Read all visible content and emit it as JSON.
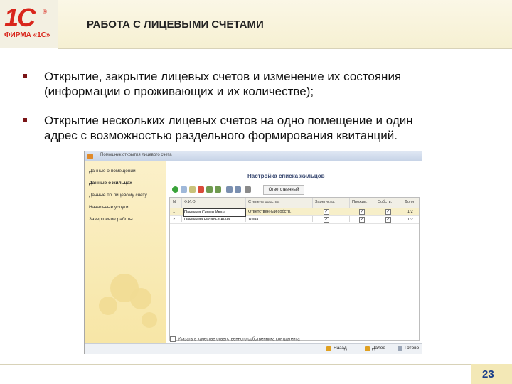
{
  "brand": {
    "logo_text": "1С",
    "logo_registered": "®",
    "caption": "ФИРМА «1С»"
  },
  "slide": {
    "title": "РАБОТА С ЛИЦЕВЫМИ СЧЕТАМИ",
    "bullets": [
      {
        "line1": "Открытие, закрытие лицевых счетов и изменение их состояния",
        "line2": "(информации о проживающих и их количестве);"
      },
      {
        "line1": "Открытие нескольких лицевых счетов на одно помещение и один",
        "line2": "адрес с возможностью раздельного формирования квитанций."
      }
    ],
    "page_number": "23"
  },
  "window": {
    "title": "Помощник открытия лицевого счета",
    "nav": [
      {
        "label": "Данные о помещении",
        "active": false
      },
      {
        "label": "Данные о жильцах",
        "active": true
      },
      {
        "label": "Данные по лицевому счету",
        "active": false
      },
      {
        "label": "Начальные услуги",
        "active": false
      },
      {
        "label": "Завершение работы",
        "active": false
      }
    ],
    "panel_title": "Настройка списка жильцов",
    "toolbar": {
      "responsible_label": "Ответственный"
    },
    "grid": {
      "headers": [
        "N",
        "Ф.И.О.",
        "Степень родства",
        "Зарегистр.",
        "Прожив.",
        "Собств.",
        "Доля"
      ],
      "rows": [
        {
          "n": "1",
          "fio": "Пакшеев Семен Иван",
          "relation": "Ответственный собств.",
          "reg": "✓",
          "live": "✓",
          "own": "✓",
          "share": "1/2"
        },
        {
          "n": "2",
          "fio": "Пакшеева Наталья Анна",
          "relation": "Жена",
          "reg": "✓",
          "live": "✓",
          "own": "✓",
          "share": "1/2"
        }
      ]
    },
    "checkbox_label": "Указать в качестве ответственного собственника контрагента",
    "statusbar": {
      "back": "Назад",
      "next": "Далее",
      "done": "Готово"
    }
  },
  "colors": {
    "brand_red": "#d9261c",
    "bullet": "#7a1416",
    "nav_bg": "#f7e6a6",
    "page_num": "#1a3f8a"
  }
}
